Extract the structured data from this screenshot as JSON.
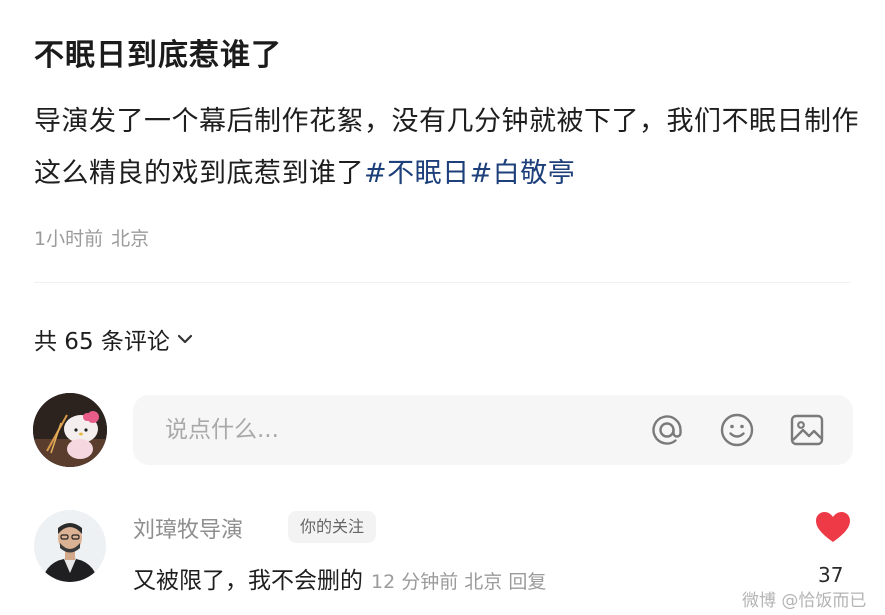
{
  "post": {
    "title": "不眠日到底惹谁了",
    "body_text": "导演发了一个幕后制作花絮，没有几分钟就被下了，我们不眠日制作这么精良的戏到底惹到谁了",
    "hashtags": [
      "#不眠日",
      "#白敬亭"
    ],
    "time": "1小时前",
    "location": "北京"
  },
  "comments_header": {
    "label": "共 65 条评论"
  },
  "composer": {
    "placeholder": "说点什么...",
    "icons": [
      "at-icon",
      "emoji-icon",
      "image-icon"
    ]
  },
  "comments": [
    {
      "author": "刘璋牧导演",
      "badge": "你的关注",
      "text": "又被限了，我不会删的",
      "time": "12 分钟前",
      "location": "北京",
      "reply_label": "回复",
      "likes": "37",
      "liked": true
    }
  ],
  "watermark": "微博 @恰饭而已",
  "colors": {
    "hashtag": "#1d3f7a",
    "heart": "#ee3a47",
    "meta": "#9b9b9b"
  }
}
